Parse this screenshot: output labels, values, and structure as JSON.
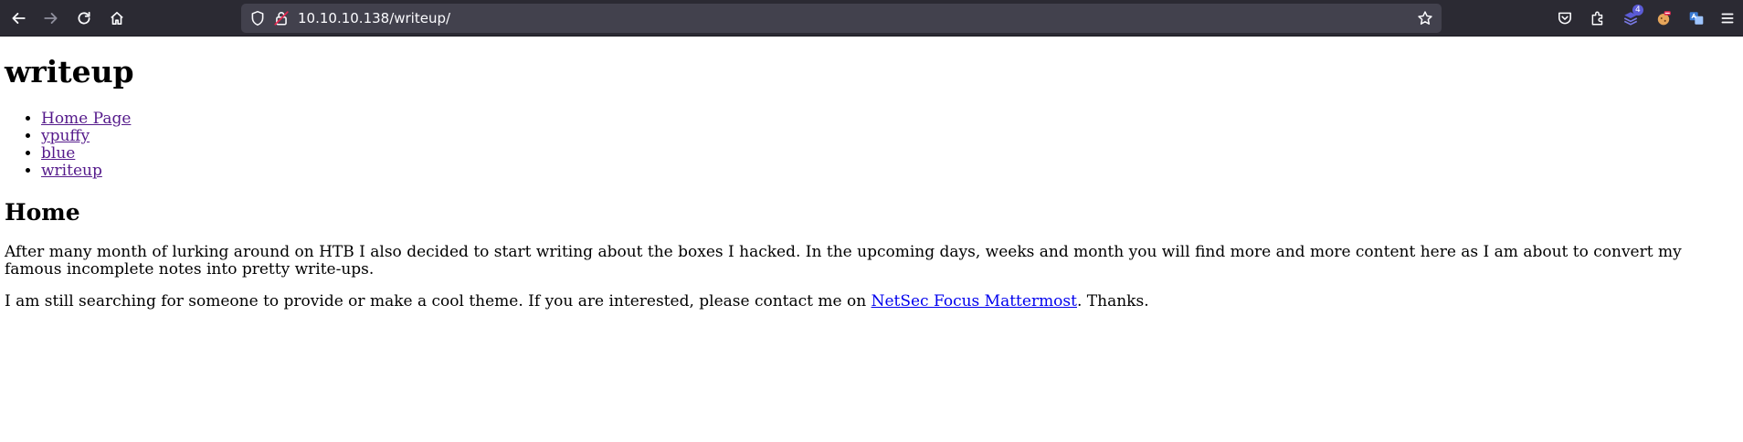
{
  "browser": {
    "url": "10.10.10.138/writeup/",
    "extension_badge_count": "4",
    "colors": {
      "toolbar_bg": "#2b2a33",
      "urlbar_bg": "#42414d",
      "icon": "#fbfbfe",
      "icon_disabled": "#8f8f9d"
    },
    "nav_buttons": [
      "back-icon",
      "forward-icon",
      "reload-icon",
      "home-icon"
    ],
    "url_icons": [
      "shield-icon",
      "insecure-lock-icon",
      "bookmark-star-icon"
    ],
    "right_icons": [
      "pocket-icon",
      "extensions-icon",
      "extension-purple-icon",
      "extension-cookie-icon",
      "extension-translate-icon",
      "menu-icon"
    ]
  },
  "page": {
    "title": "writeup",
    "nav": [
      {
        "label": "Home Page"
      },
      {
        "label": "ypuffy"
      },
      {
        "label": "blue"
      },
      {
        "label": "writeup"
      }
    ],
    "section_title": "Home",
    "paragraph1": "After many month of lurking around on HTB I also decided to start writing about the boxes I hacked. In the upcoming days, weeks and month you will find more and more content here as I am about to convert my famous incomplete notes into pretty write-ups.",
    "paragraph2_before": "I am still searching for someone to provide or make a cool theme. If you are interested, please contact me on ",
    "paragraph2_link": "NetSec Focus Mattermost",
    "paragraph2_after": ". Thanks.",
    "colors": {
      "visited_link": "#551a8b",
      "link": "#0000ee"
    }
  }
}
